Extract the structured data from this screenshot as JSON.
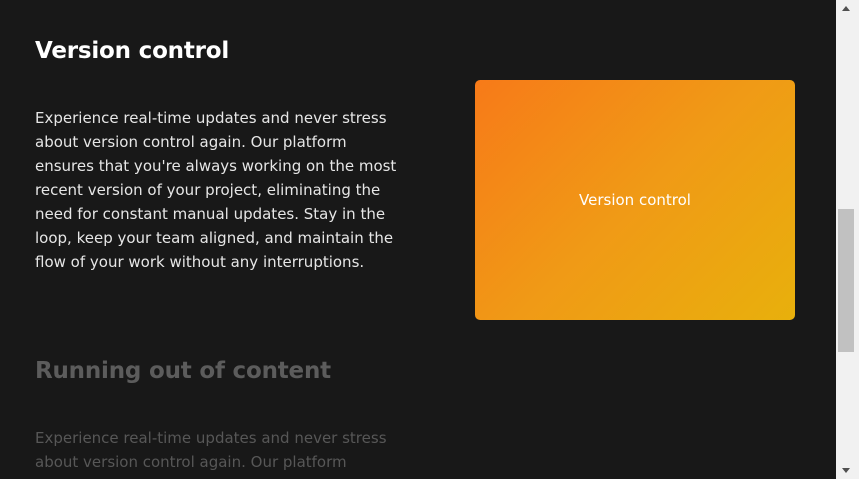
{
  "sections": [
    {
      "title": "Version control",
      "body": "Experience real-time updates and never stress about version control again. Our platform ensures that you're always working on the most recent version of your project, eliminating the need for constant manual updates. Stay in the loop, keep your team aligned, and maintain the flow of your work without any interruptions."
    },
    {
      "title": "Running out of content",
      "body": "Experience real-time updates and never stress about version control again. Our platform ensures that"
    }
  ],
  "feature_card": {
    "label": "Version control"
  },
  "colors": {
    "background": "#181818",
    "card_gradient_start": "#f77a18",
    "card_gradient_end": "#e8b00c",
    "faded_text": "#5c5c5c"
  }
}
